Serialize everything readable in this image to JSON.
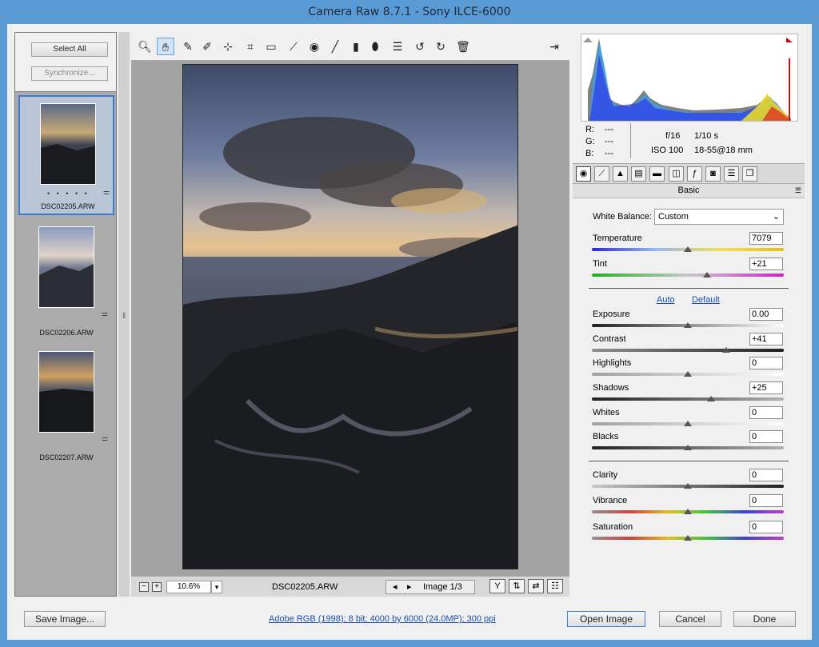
{
  "window": {
    "title": "Camera Raw 8.7.1  -  Sony ILCE-6000"
  },
  "filmstrip": {
    "select_all": "Select All",
    "synchronize": "Synchronize...",
    "items": [
      {
        "name": "DSC02205.ARW",
        "rating": "• • • • •"
      },
      {
        "name": "DSC02206.ARW"
      },
      {
        "name": "DSC02207.ARW"
      }
    ]
  },
  "toolbar": {
    "tools": [
      "zoom-icon",
      "hand-icon",
      "white-balance-icon",
      "color-sampler-icon",
      "targeted-adjust-icon",
      "crop-icon",
      "straighten-icon",
      "spot-removal-icon",
      "red-eye-icon",
      "adjustment-brush-icon",
      "graduated-filter-icon",
      "radial-filter-icon",
      "preferences-icon",
      "rotate-left-icon",
      "rotate-right-icon",
      "trash-icon"
    ],
    "open_workflow": "open-in-photoshop-icon"
  },
  "preview_bar": {
    "zoom": "10.6%",
    "filename": "DSC02205.ARW",
    "image_counter": "Image 1/3"
  },
  "readout": {
    "r_label": "R:",
    "r_val": "---",
    "g_label": "G:",
    "g_val": "---",
    "b_label": "B:",
    "b_val": "---",
    "aperture": "f/16",
    "shutter": "1/10 s",
    "iso": "ISO 100",
    "lens": "18-55@18 mm"
  },
  "panel": {
    "title": "Basic",
    "white_balance_label": "White Balance:",
    "white_balance_value": "Custom",
    "auto": "Auto",
    "default": "Default",
    "sliders": [
      {
        "key": "temperature",
        "label": "Temperature",
        "value": "7079",
        "pos": 0.5
      },
      {
        "key": "tint",
        "label": "Tint",
        "value": "+21",
        "pos": 0.6
      },
      {
        "key": "exposure",
        "label": "Exposure",
        "value": "0.00",
        "pos": 0.5
      },
      {
        "key": "contrast",
        "label": "Contrast",
        "value": "+41",
        "pos": 0.7
      },
      {
        "key": "highlights",
        "label": "Highlights",
        "value": "0",
        "pos": 0.5
      },
      {
        "key": "shadows",
        "label": "Shadows",
        "value": "+25",
        "pos": 0.62
      },
      {
        "key": "whites",
        "label": "Whites",
        "value": "0",
        "pos": 0.5
      },
      {
        "key": "blacks",
        "label": "Blacks",
        "value": "0",
        "pos": 0.5
      },
      {
        "key": "clarity",
        "label": "Clarity",
        "value": "0",
        "pos": 0.5
      },
      {
        "key": "vibrance",
        "label": "Vibrance",
        "value": "0",
        "pos": 0.5
      },
      {
        "key": "saturation",
        "label": "Saturation",
        "value": "0",
        "pos": 0.5
      }
    ]
  },
  "bottom": {
    "save_image": "Save Image...",
    "workflow_link": "Adobe RGB (1998); 8 bit; 4000 by 6000 (24.0MP); 300 ppi",
    "open_image": "Open Image",
    "cancel": "Cancel",
    "done": "Done"
  },
  "colors": {
    "accent": "#3a7bd5",
    "titlebar": "#5b9bd5",
    "link": "#1a4fb0"
  }
}
